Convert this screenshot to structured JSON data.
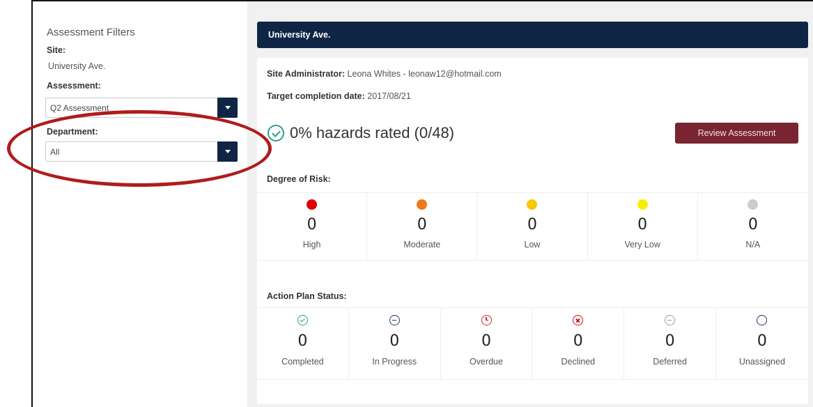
{
  "sidebar": {
    "title": "Assessment Filters",
    "site_label": "Site:",
    "site_value": "University Ave.",
    "assessment_label": "Assessment:",
    "assessment_value": "Q2 Assessment",
    "department_label": "Department:",
    "department_value": "All"
  },
  "banner": {
    "title": "University Ave."
  },
  "info": {
    "admin_label": "Site Administrator:",
    "admin_value": "Leona Whites - leonaw12@hotmail.com",
    "target_label": "Target completion date:",
    "target_value": "2017/08/21"
  },
  "progress": {
    "text": "0% hazards rated (0/48)"
  },
  "review_button": "Review Assessment",
  "risk": {
    "label": "Degree of Risk:",
    "items": [
      {
        "count": "0",
        "label": "High",
        "color": "#e00000"
      },
      {
        "count": "0",
        "label": "Moderate",
        "color": "#f07818"
      },
      {
        "count": "0",
        "label": "Low",
        "color": "#f5c800"
      },
      {
        "count": "0",
        "label": "Very Low",
        "color": "#f5f000"
      },
      {
        "count": "0",
        "label": "N/A",
        "color": "#cccccc"
      }
    ]
  },
  "status": {
    "label": "Action Plan Status:",
    "items": [
      {
        "count": "0",
        "label": "Completed",
        "icon": "check-circle-icon",
        "color": "#2a9d8f"
      },
      {
        "count": "0",
        "label": "In Progress",
        "icon": "minus-circle-icon",
        "color": "#1f3a5a"
      },
      {
        "count": "0",
        "label": "Overdue",
        "icon": "clock-icon",
        "color": "#d62828"
      },
      {
        "count": "0",
        "label": "Declined",
        "icon": "x-circle-icon",
        "color": "#c1121f"
      },
      {
        "count": "0",
        "label": "Deferred",
        "icon": "minus-circle-icon",
        "color": "#9a9a9a"
      },
      {
        "count": "0",
        "label": "Unassigned",
        "icon": "empty-circle-icon",
        "color": "#1f3a5a"
      }
    ]
  },
  "colors": {
    "navy": "#0f2545",
    "button": "#7b2431",
    "annotation": "#b01c1c"
  }
}
